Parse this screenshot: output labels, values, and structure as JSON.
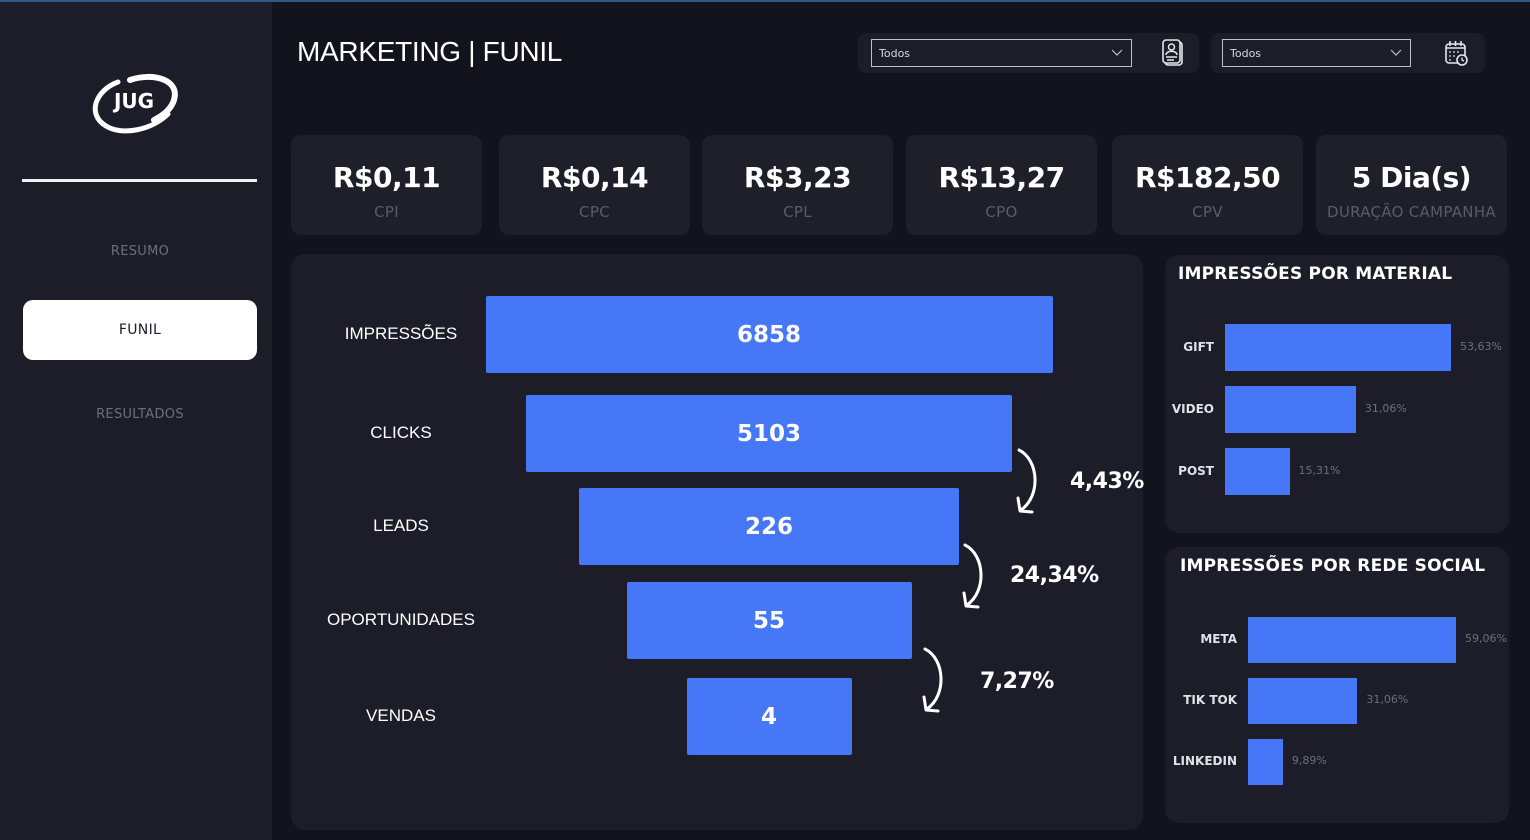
{
  "app": {
    "title": "MARKETING | FUNIL",
    "accent_color": "#4577f6",
    "logo_text": "JUG"
  },
  "sidebar": {
    "items": [
      {
        "label": "RESUMO",
        "active": false
      },
      {
        "label": "FUNIL",
        "active": true
      },
      {
        "label": "RESULTADOS",
        "active": false
      }
    ]
  },
  "filters": [
    {
      "value": "Todos",
      "icon": "id-badge-icon"
    },
    {
      "value": "Todos",
      "icon": "calendar-clock-icon"
    }
  ],
  "kpis": [
    {
      "value": "R$0,11",
      "label": "CPI"
    },
    {
      "value": "R$0,14",
      "label": "CPC"
    },
    {
      "value": "R$3,23",
      "label": "CPL"
    },
    {
      "value": "R$13,27",
      "label": "CPO"
    },
    {
      "value": "R$182,50",
      "label": "CPV"
    },
    {
      "value": "5 Dia(s)",
      "label": "DURAÇÃO CAMPANHA"
    }
  ],
  "chart_data": [
    {
      "type": "bar",
      "subtype": "funnel",
      "title": "",
      "categories": [
        "IMPRESSÕES",
        "CLICKS",
        "LEADS",
        "OPORTUNIDADES",
        "VENDAS"
      ],
      "values": [
        6858,
        5103,
        226,
        55,
        4
      ],
      "value_labels": [
        "6858",
        "5103",
        "226",
        "55",
        "4"
      ],
      "conversion_rates": [
        {
          "from": "CLICKS",
          "to": "LEADS",
          "label": "4,43%"
        },
        {
          "from": "LEADS",
          "to": "OPORTUNIDADES",
          "label": "24,34%"
        },
        {
          "from": "OPORTUNIDADES",
          "to": "VENDAS",
          "label": "7,27%"
        }
      ]
    },
    {
      "type": "bar",
      "orientation": "horizontal",
      "title": "IMPRESSÕES POR MATERIAL",
      "categories": [
        "GIFT",
        "VIDEO",
        "POST"
      ],
      "values": [
        53.63,
        31.06,
        15.31
      ],
      "value_labels": [
        "53,63%",
        "31,06%",
        "15,31%"
      ],
      "xlim": [
        0,
        53.63
      ]
    },
    {
      "type": "bar",
      "orientation": "horizontal",
      "title": "IMPRESSÕES POR REDE SOCIAL",
      "categories": [
        "META",
        "TIK TOK",
        "LINKEDIN"
      ],
      "values": [
        59.06,
        31.06,
        9.89
      ],
      "value_labels": [
        "59,06%",
        "31,06%",
        "9,89%"
      ],
      "xlim": [
        0,
        59.06
      ]
    }
  ]
}
